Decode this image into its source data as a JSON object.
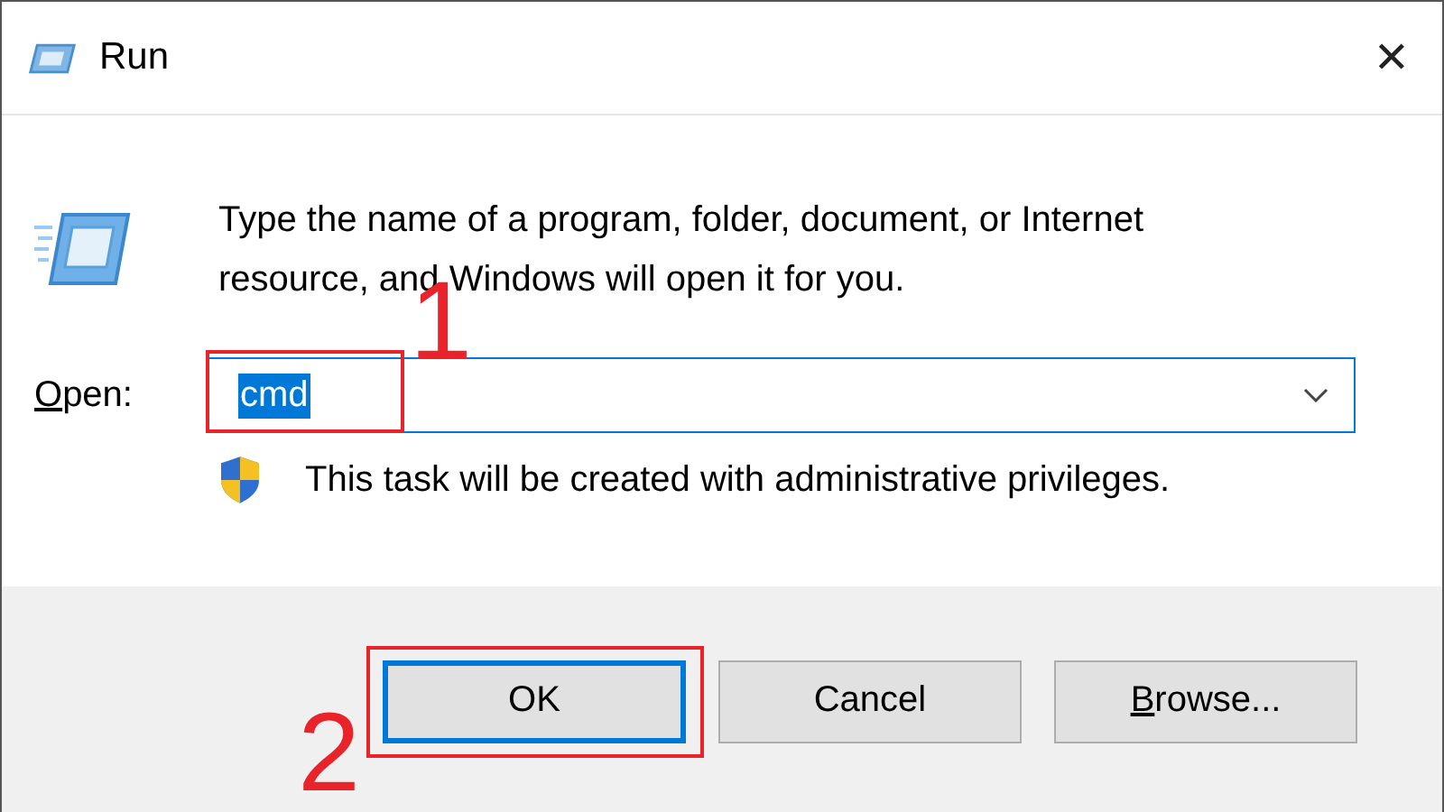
{
  "window": {
    "title": "Run",
    "close": "✕"
  },
  "description": "Type the name of a program, folder, document, or Internet resource, and Windows will open it for you.",
  "open_field": {
    "label": "Open:",
    "label_underline_first": true,
    "value": "cmd",
    "value_selected": true,
    "focused": true
  },
  "notice": "This task will be created with administrative privileges.",
  "buttons": [
    {
      "label": "OK",
      "underline_first": false,
      "default": true
    },
    {
      "label": "Cancel",
      "underline_first": false,
      "default": false
    },
    {
      "label": "Browse...",
      "underline_first": true,
      "default": false
    }
  ],
  "annotations": [
    {
      "kind": "field",
      "number": "1"
    },
    {
      "kind": "button",
      "number": "2"
    }
  ]
}
